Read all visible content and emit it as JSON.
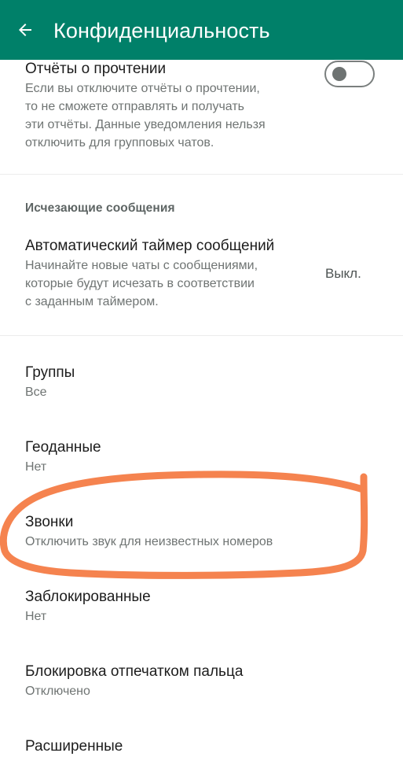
{
  "header": {
    "title": "Конфиденциальность",
    "background": "#008069"
  },
  "read_receipts": {
    "title": "Отчёты о прочтении",
    "description_lines": [
      "Если вы отключите отчёты о прочтении,",
      "то не сможете отправлять и получать",
      "эти отчёты. Данные уведомления нельзя",
      "отключить для групповых чатов."
    ],
    "toggle_on": false
  },
  "disappearing": {
    "section_title": "Исчезающие сообщения",
    "timer_title": "Автоматический таймер сообщений",
    "timer_description_lines": [
      "Начинайте новые чаты с сообщениями,",
      "которые будут исчезать в соответствии",
      "с заданным таймером."
    ],
    "timer_value": "Выкл."
  },
  "items": [
    {
      "title": "Группы",
      "value": "Все"
    },
    {
      "title": "Геоданные",
      "value": "Нет"
    },
    {
      "title": "Звонки",
      "value": "Отключить звук для неизвестных номеров"
    },
    {
      "title": "Заблокированные",
      "value": "Нет"
    },
    {
      "title": "Блокировка отпечатком пальца",
      "value": "Отключено"
    },
    {
      "title": "Расширенные",
      "value": ""
    }
  ],
  "annotation_color": "#f5834f"
}
